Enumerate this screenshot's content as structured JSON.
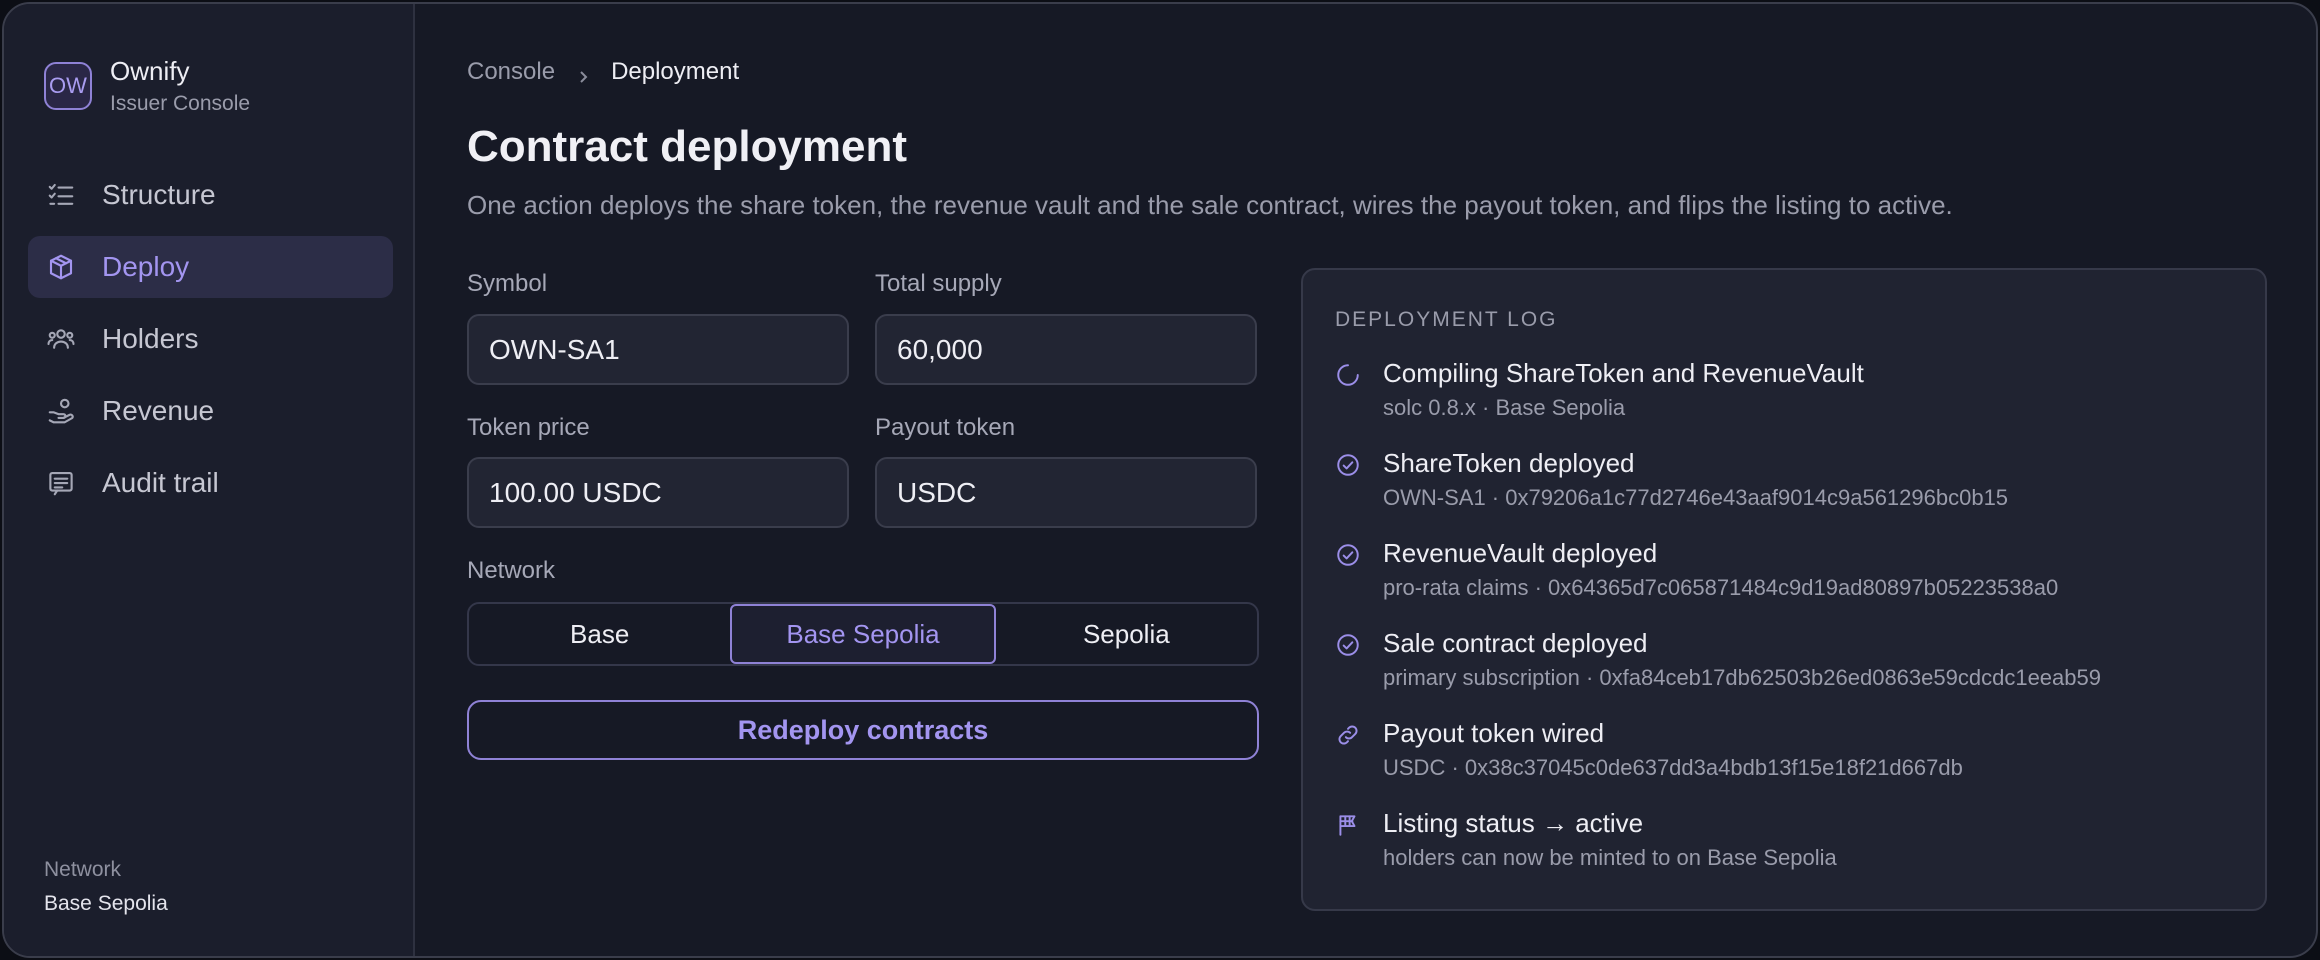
{
  "brand": {
    "logo_text": "OW",
    "name": "Ownify",
    "subtitle": "Issuer Console"
  },
  "sidebar": {
    "items": [
      {
        "label": "Structure",
        "icon": "list-checks-icon",
        "active": false
      },
      {
        "label": "Deploy",
        "icon": "box-icon",
        "active": true
      },
      {
        "label": "Holders",
        "icon": "users-icon",
        "active": false
      },
      {
        "label": "Revenue",
        "icon": "hand-coins-icon",
        "active": false
      },
      {
        "label": "Audit trail",
        "icon": "receipt-icon",
        "active": false
      }
    ],
    "footer": {
      "label": "Network",
      "value": "Base Sepolia"
    }
  },
  "breadcrumb": {
    "parent": "Console",
    "current": "Deployment"
  },
  "page": {
    "title": "Contract deployment",
    "description": "One action deploys the share token, the revenue vault and the sale contract, wires the payout token, and flips the listing to active."
  },
  "form": {
    "symbol": {
      "label": "Symbol",
      "value": "OWN-SA1"
    },
    "total_supply": {
      "label": "Total supply",
      "value": "60,000"
    },
    "token_price": {
      "label": "Token price",
      "value": "100.00 USDC"
    },
    "payout_token": {
      "label": "Payout token",
      "value": "USDC"
    },
    "network": {
      "label": "Network",
      "options": [
        "Base",
        "Base Sepolia",
        "Sepolia"
      ],
      "selected": "Base Sepolia"
    },
    "redeploy_label": "Redeploy contracts"
  },
  "log": {
    "heading": "DEPLOYMENT LOG",
    "entries": [
      {
        "title": "Compiling ShareToken and RevenueVault",
        "detail": "solc 0.8.x · Base Sepolia",
        "icon": "spinner-icon"
      },
      {
        "title": "ShareToken deployed",
        "detail": "OWN-SA1 · 0x79206a1c77d2746e43aaf9014c9a561296bc0b15",
        "icon": "check-circle-icon"
      },
      {
        "title": "RevenueVault deployed",
        "detail": "pro-rata claims · 0x64365d7c065871484c9d19ad80897b05223538a0",
        "icon": "check-circle-icon"
      },
      {
        "title": "Sale contract deployed",
        "detail": "primary subscription · 0xfa84ceb17db62503b26ed0863e59cdcdc1eeab59",
        "icon": "check-circle-icon"
      },
      {
        "title": "Payout token wired",
        "detail": "USDC · 0x38c37045c0de637dd3a4bdb13f15e18f21d667db",
        "icon": "link-icon"
      },
      {
        "title": "Listing status → active",
        "detail": "holders can now be minted to on Base Sepolia",
        "icon": "flag-icon"
      }
    ]
  },
  "colors": {
    "accent": "#a395f0",
    "background": "#161925",
    "sidebar": "#1b1e2c",
    "panel": "#202331"
  }
}
